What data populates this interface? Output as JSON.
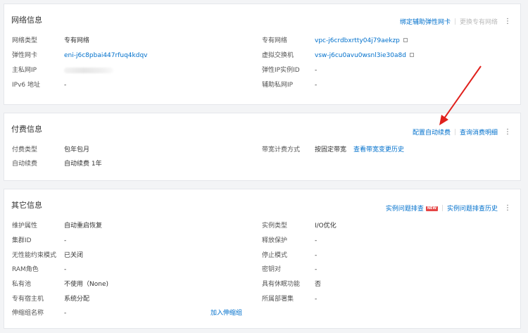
{
  "network": {
    "title": "网络信息",
    "actions": {
      "bind_eni": "绑定辅助弹性网卡",
      "change_vpc": "更换专有网络"
    },
    "left": [
      {
        "label": "网络类型",
        "value": "专有网络"
      },
      {
        "label": "弹性网卡",
        "value": "eni-j6c8pbai447rfuq4kdqv"
      },
      {
        "label": "主私网IP",
        "value": ""
      },
      {
        "label": "IPv6 地址",
        "value": "-"
      }
    ],
    "right": [
      {
        "label": "专有网络",
        "value": "vpc-j6crdbxrtty04j79aekzp"
      },
      {
        "label": "虚拟交换机",
        "value": "vsw-j6cu0avu0wsnl3ie30a8d"
      },
      {
        "label": "弹性IP实例ID",
        "value": "-"
      },
      {
        "label": "辅助私网IP",
        "value": "-"
      }
    ]
  },
  "billing": {
    "title": "付费信息",
    "actions": {
      "auto_renew": "配置自动续费",
      "query_detail": "查询消费明细"
    },
    "left": [
      {
        "label": "付费类型",
        "value": "包年包月"
      },
      {
        "label": "自动续费",
        "value": "自动续费 1年"
      }
    ],
    "right": [
      {
        "label": "带宽计费方式",
        "value": "按固定带宽",
        "link": "查看带宽变更历史"
      }
    ]
  },
  "other": {
    "title": "其它信息",
    "actions": {
      "troubleshoot": "实例问题排查",
      "new_badge": "NEW",
      "history": "实例问题排查历史"
    },
    "left": [
      {
        "label": "维护属性",
        "value": "自动重启恢复"
      },
      {
        "label": "集群ID",
        "value": "-"
      },
      {
        "label": "无性能约束模式",
        "value": "已关闭"
      },
      {
        "label": "RAM角色",
        "value": "-"
      },
      {
        "label": "私有池",
        "value": "不使用（None)"
      },
      {
        "label": "专有宿主机",
        "value": "系统分配"
      },
      {
        "label": "伸缩组名称",
        "value": "-",
        "link": "加入伸缩组"
      }
    ],
    "right": [
      {
        "label": "实例类型",
        "value": "I/O优化"
      },
      {
        "label": "释放保护",
        "value": "-"
      },
      {
        "label": "停止模式",
        "value": "-"
      },
      {
        "label": "密钥对",
        "value": "-"
      },
      {
        "label": "具有休眠功能",
        "value": "否"
      },
      {
        "label": "所属部署集",
        "value": "-"
      }
    ]
  },
  "colors": {
    "link": "#0070cc",
    "arrow": "#e0201c",
    "badge": "#e54545"
  }
}
